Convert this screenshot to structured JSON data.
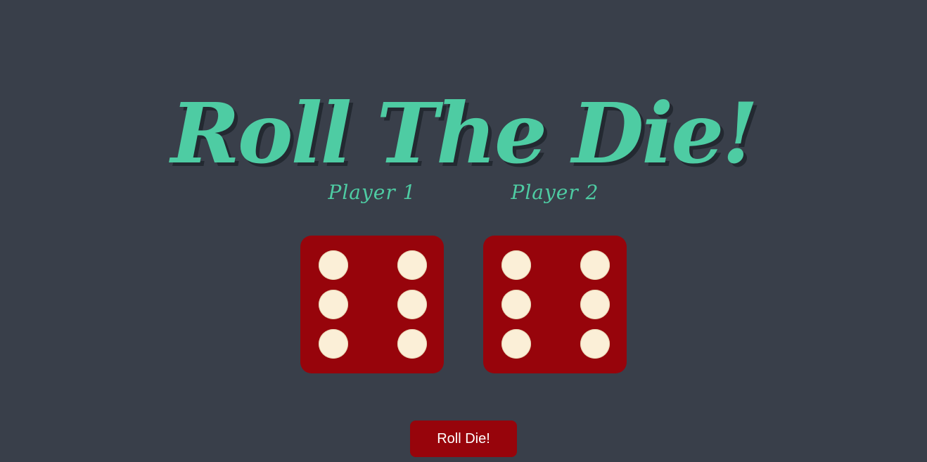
{
  "title": "Roll The Die!",
  "players": [
    {
      "label": "Player 1",
      "die_value": 6
    },
    {
      "label": "Player 2",
      "die_value": 6
    }
  ],
  "roll_button_label": "Roll Die!",
  "colors": {
    "background": "#393f4a",
    "accent": "#4ecca3",
    "die": "#97040b",
    "pip": "#fbefd7",
    "button": "#97040b",
    "button_text": "#ffffff"
  }
}
